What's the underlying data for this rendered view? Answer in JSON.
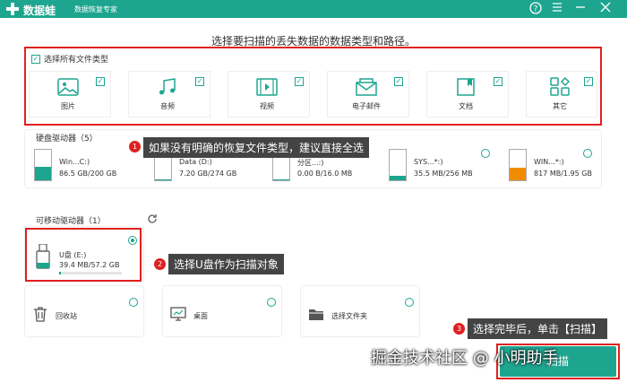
{
  "app": {
    "name": "数据蛙",
    "subtitle": "数据恢复专家"
  },
  "titlebar_icons": [
    "help-icon",
    "menu-icon",
    "minimize-icon",
    "close-icon"
  ],
  "heading": "选择要扫描的丢失数据的数据类型和路径。",
  "file_types": {
    "select_all_label": "选择所有文件类型",
    "select_all_checked": true,
    "items": [
      {
        "label": "图片",
        "icon": "image-icon",
        "checked": true
      },
      {
        "label": "音频",
        "icon": "audio-icon",
        "checked": true
      },
      {
        "label": "视频",
        "icon": "video-icon",
        "checked": true
      },
      {
        "label": "电子邮件",
        "icon": "email-icon",
        "checked": true
      },
      {
        "label": "文档",
        "icon": "document-icon",
        "checked": true
      },
      {
        "label": "其它",
        "icon": "other-icon",
        "checked": true
      }
    ]
  },
  "hard_drives": {
    "label": "硬盘驱动器（5）",
    "items": [
      {
        "name": "Win...C:)",
        "size": "86.5 GB/200 GB",
        "fill": 0.43,
        "color": "#1ea58f"
      },
      {
        "name": "Data (D:)",
        "size": "7.20 GB/274 GB",
        "fill": 0.03,
        "color": "#1ea58f"
      },
      {
        "name": "分区...:)",
        "size": "0.00  B/16.0 MB",
        "fill": 0.0,
        "color": "#1ea58f"
      },
      {
        "name": "SYS...*:)",
        "size": "35.5 MB/256 MB",
        "fill": 0.14,
        "color": "#1ea58f"
      },
      {
        "name": "WIN...*:)",
        "size": "817 MB/1.95 GB",
        "fill": 0.42,
        "color": "#f08c00"
      }
    ]
  },
  "removable_drives": {
    "label": "可移动驱动器（1）",
    "items": [
      {
        "name": "U盘 (E:)",
        "size": "39.4 MB/57.2 GB",
        "fill": 0.01,
        "selected": true
      }
    ]
  },
  "locations": [
    {
      "label": "回收站",
      "icon": "trash-icon"
    },
    {
      "label": "桌面",
      "icon": "desktop-icon"
    },
    {
      "label": "选择文件夹",
      "icon": "folder-icon"
    }
  ],
  "annotations": [
    {
      "num": "1",
      "text": "如果没有明确的恢复文件类型，建议直接全选"
    },
    {
      "num": "2",
      "text": "选择U盘作为扫描对象"
    },
    {
      "num": "3",
      "text": "选择完毕后，单击【扫描】"
    }
  ],
  "scan_button": "扫描",
  "watermark": "掘金技术社区 @ 小明助手",
  "colors": {
    "accent": "#1ea58f",
    "highlight": "#e02020"
  }
}
